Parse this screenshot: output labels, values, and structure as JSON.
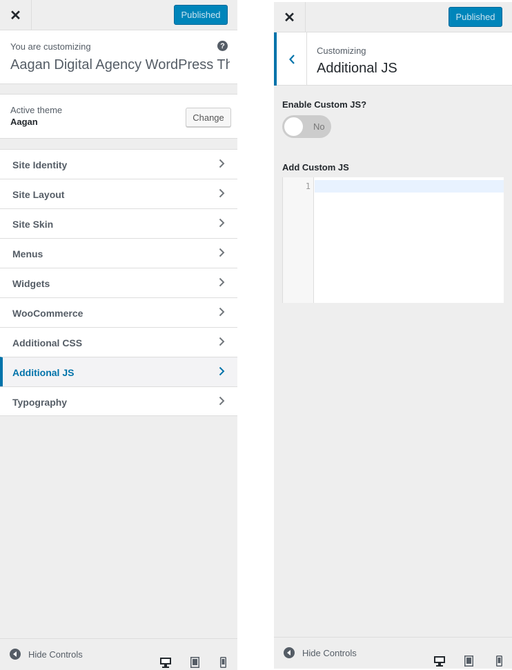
{
  "colors": {
    "accent": "#0073aa",
    "publish_button": "#0085ba",
    "panel_bg": "#eeeeee"
  },
  "left": {
    "header": {
      "close_icon": "close-icon",
      "publish_label": "Published"
    },
    "info": {
      "subtitle": "You are customizing",
      "site_title": "Aagan Digital Agency WordPress Th…",
      "help_icon": "help-icon"
    },
    "theme": {
      "label": "Active theme",
      "name": "Aagan",
      "change_label": "Change"
    },
    "menu": [
      {
        "label": "Site Identity"
      },
      {
        "label": "Site Layout"
      },
      {
        "label": "Site Skin"
      },
      {
        "label": "Menus"
      },
      {
        "label": "Widgets"
      },
      {
        "label": "WooCommerce"
      },
      {
        "label": "Additional CSS"
      },
      {
        "label": "Additional JS",
        "active": true
      },
      {
        "label": "Typography"
      }
    ],
    "footer": {
      "hide_label": "Hide Controls",
      "devices": [
        "desktop-icon",
        "tablet-icon",
        "mobile-icon"
      ]
    }
  },
  "right": {
    "header": {
      "close_icon": "close-icon",
      "publish_label": "Published"
    },
    "section": {
      "subtitle": "Customizing",
      "title": "Additional JS"
    },
    "enable_label": "Enable Custom JS?",
    "toggle_state": "No",
    "add_label": "Add Custom JS",
    "editor": {
      "line_number": "1"
    },
    "footer": {
      "hide_label": "Hide Controls",
      "devices": [
        "desktop-icon",
        "tablet-icon",
        "mobile-icon"
      ]
    }
  }
}
